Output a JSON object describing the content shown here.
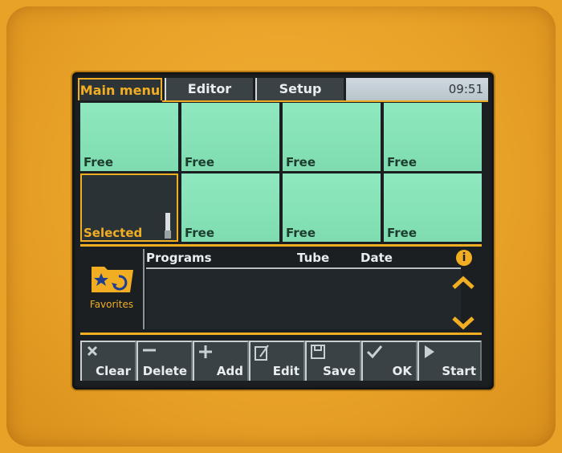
{
  "tabs": {
    "main": "Main menu",
    "editor": "Editor",
    "setup": "Setup"
  },
  "clock": "09:51",
  "slots": [
    "Free",
    "Free",
    "Free",
    "Free",
    "Selected",
    "Free",
    "Free",
    "Free"
  ],
  "favorites": {
    "label": "Favorites"
  },
  "list": {
    "col_programs": "Programs",
    "col_tube": "Tube",
    "col_date": "Date"
  },
  "toolbar": {
    "clear": "Clear",
    "delete": "Delete",
    "add": "Add",
    "edit": "Edit",
    "save": "Save",
    "ok": "OK",
    "start": "Start"
  },
  "colors": {
    "accent": "#f2ae23",
    "free_slot": "#8fe8bf",
    "screen_bg": "#1b1f22",
    "device_body": "#e9a228"
  }
}
